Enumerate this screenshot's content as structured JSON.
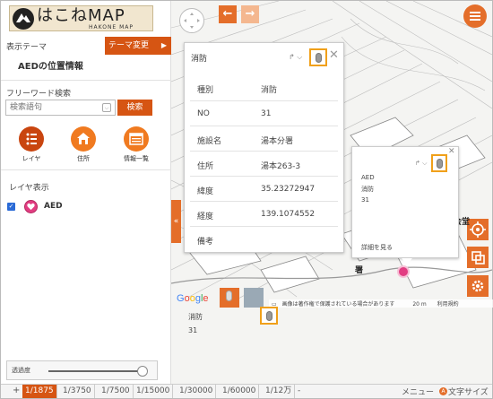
{
  "logo": {
    "title": "はこねMAP",
    "subtitle": "HAKONE MAP"
  },
  "sidebar": {
    "theme_label": "表示テーマ",
    "theme_change_button": "テーマ変更",
    "theme_name": "AEDの位置情報",
    "freeword_label": "フリーワード検索",
    "search_placeholder": "検索語句",
    "search_button": "検索",
    "tools": [
      {
        "label": "レイヤ",
        "icon": "layers-icon",
        "color": "#c9450f"
      },
      {
        "label": "住所",
        "icon": "house-icon",
        "color": "#f07a20"
      },
      {
        "label": "情報一覧",
        "icon": "list-icon",
        "color": "#f07a20"
      }
    ],
    "layer_section_label": "レイヤ表示",
    "layers": [
      {
        "name": "AED",
        "checked": true,
        "icon": "aed-heart-icon",
        "color": "#e23d82"
      }
    ],
    "opacity_label": "透過度",
    "opacity_value": 0.95
  },
  "popup": {
    "title": "消防",
    "arrows": "↱ ⌵",
    "rows": [
      {
        "key": "種別",
        "value": "消防"
      },
      {
        "key": "NO",
        "value": "31"
      },
      {
        "key": "施設名",
        "value": "湯本分署"
      },
      {
        "key": "住所",
        "value": "湯本263-3"
      },
      {
        "key": "緯度",
        "value": "35.23272947"
      },
      {
        "key": "経度",
        "value": "139.1074552"
      },
      {
        "key": "備考",
        "value": ""
      }
    ]
  },
  "small_popup": {
    "lines": [
      "AED",
      "消防",
      "31"
    ],
    "details_link": "詳細を見る"
  },
  "map": {
    "labels": [
      "公会堂",
      "署"
    ],
    "attribution": "画像は著作権で保護されている場合があります",
    "scale_text": "20 m",
    "terms": "利用規約",
    "under_labels": [
      "消防",
      "31"
    ]
  },
  "scalebar": {
    "plus": "+",
    "scales": [
      "1/1875",
      "1/3750",
      "1/7500",
      "1/15000",
      "1/30000",
      "1/60000",
      "1/12万",
      "-"
    ],
    "active_index": 0,
    "menu": "メニュー",
    "font_size": "文字サイズ"
  },
  "colors": {
    "accent": "#e46e2a",
    "dark_accent": "#d65513",
    "highlight": "#f0a01a"
  }
}
